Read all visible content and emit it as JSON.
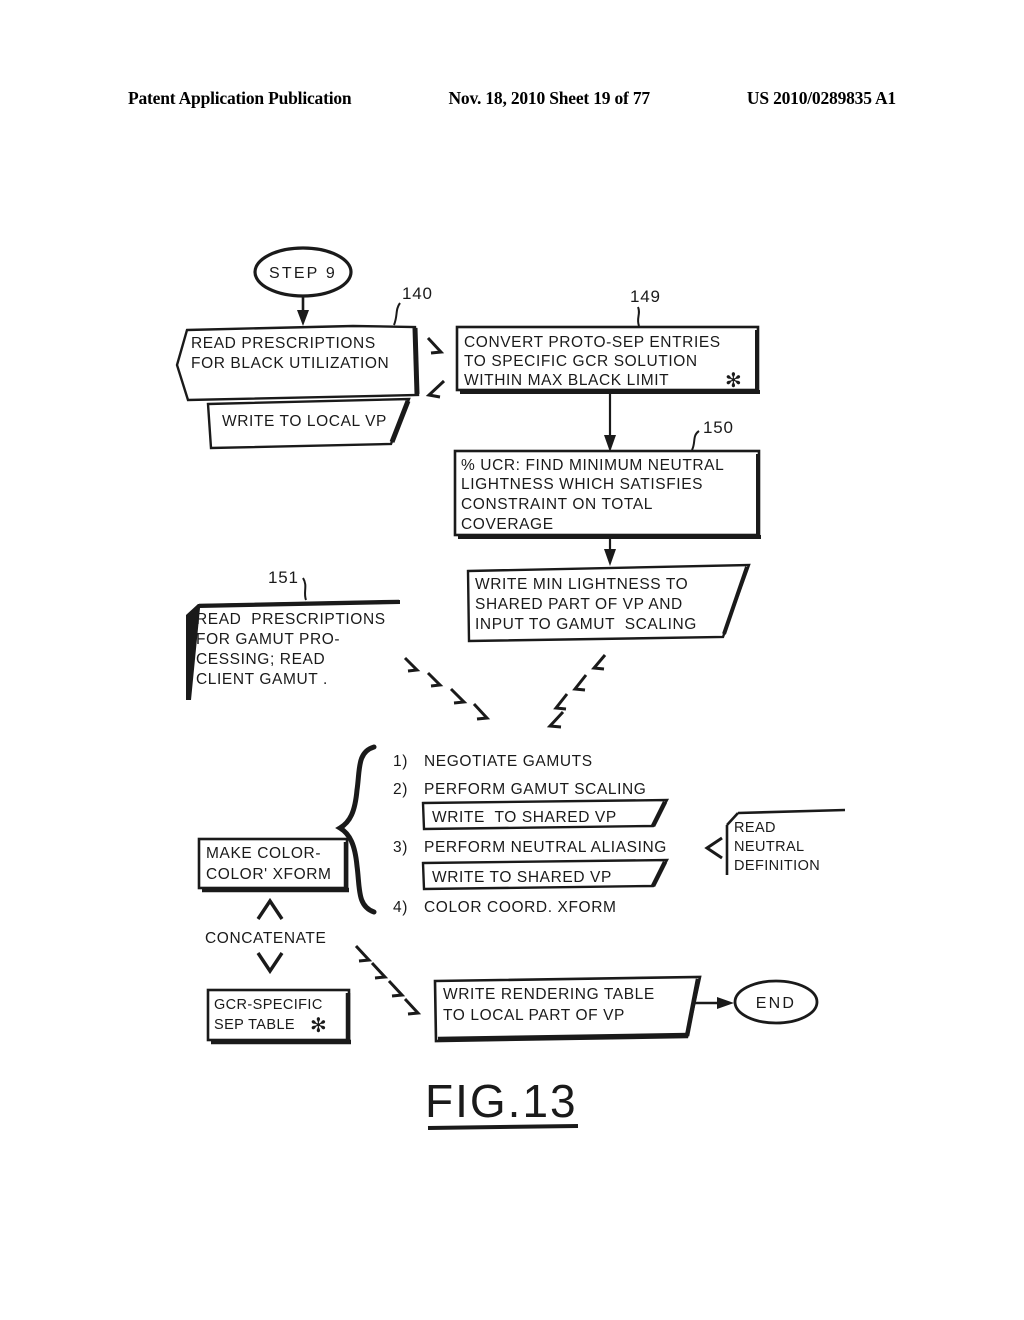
{
  "header": {
    "publication": "Patent Application Publication",
    "date_sheet": "Nov. 18, 2010   Sheet 19 of 77",
    "patent_number": "US 2010/0289835 A1"
  },
  "figure": {
    "caption": "FIG.13"
  },
  "nodes": {
    "step9": {
      "label": "STEP 9"
    },
    "read_black": {
      "ref": "140",
      "lines": [
        "READ PRESCRIPTIONS",
        "FOR BLACK UTILIZATION"
      ]
    },
    "write_local_vp": {
      "lines": [
        "WRITE TO LOCAL VP"
      ]
    },
    "convert_proto_sep": {
      "ref": "149",
      "lines": [
        "CONVERT PROTO-SEP ENTRIES",
        "TO SPECIFIC GCR SOLUTION",
        "WITHIN MAX BLACK LIMIT"
      ],
      "asterisk": "✻"
    },
    "ucr": {
      "ref": "150",
      "lines": [
        "% UCR: FIND MINIMUM NEUTRAL",
        "LIGHTNESS WHICH SATISFIES",
        "CONSTRAINT ON TOTAL",
        "COVERAGE"
      ]
    },
    "write_min_lightness": {
      "lines": [
        "WRITE MIN LIGHTNESS TO",
        "SHARED PART OF VP AND",
        "INPUT TO GAMUT  SCALING"
      ]
    },
    "read_gamut": {
      "ref": "151",
      "lines": [
        "READ  PRESCRIPTIONS",
        "FOR GAMUT PRO-",
        "CESSING; READ",
        "CLIENT GAMUT ."
      ]
    },
    "make_xform": {
      "lines": [
        "MAKE COLOR-",
        "COLOR' XFORM"
      ]
    },
    "concatenate": {
      "label": "CONCATENATE"
    },
    "gcr_sep_table": {
      "lines": [
        "GCR-SPECIFIC",
        "SEP TABLE"
      ],
      "asterisk": "✻"
    },
    "read_neutral_def": {
      "lines": [
        "READ",
        "NEUTRAL",
        "DEFINITION"
      ]
    },
    "write_rendering_table": {
      "lines": [
        "WRITE RENDERING TABLE",
        "TO LOCAL PART OF VP"
      ]
    },
    "end": {
      "label": "END"
    }
  },
  "steps_list": [
    {
      "num": "1)",
      "text": "NEGOTIATE GAMUTS"
    },
    {
      "num": "2)",
      "text": "PERFORM GAMUT SCALING"
    },
    {
      "num": "3)",
      "text": "PERFORM NEUTRAL ALIASING"
    },
    {
      "num": "4)",
      "text": "COLOR COORD. XFORM"
    }
  ],
  "shared_vp": {
    "first": "WRITE  TO SHARED VP",
    "second": "WRITE TO SHARED VP"
  },
  "colors": {
    "ink": "#1a1a1a",
    "paper": "#ffffff"
  }
}
